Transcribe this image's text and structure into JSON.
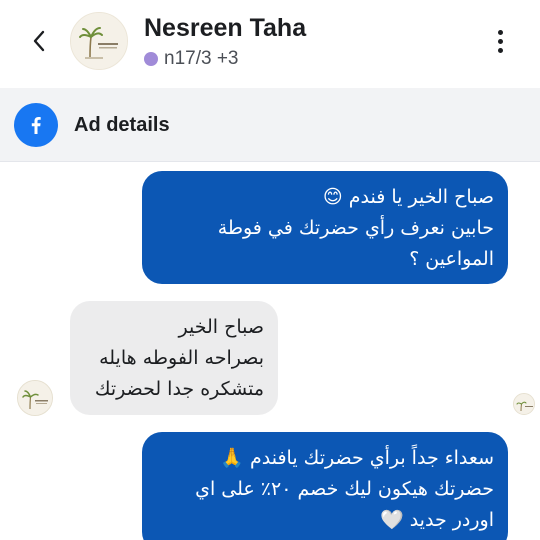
{
  "header": {
    "contact_name": "Nesreen Taha",
    "tag_text": "n17/3 +3",
    "tag_color": "#a08bd8",
    "back_icon": "chevron-left-icon",
    "more_icon": "more-vertical-icon"
  },
  "ad_bar": {
    "label": "Ad details",
    "icon": "facebook-icon",
    "icon_color": "#1877f2"
  },
  "messages": [
    {
      "direction": "outgoing",
      "lines": [
        "صباح الخير يا فندم 😊",
        "حابين نعرف رأي حضرتك في فوطة",
        "المواعين ؟"
      ]
    },
    {
      "direction": "incoming",
      "lines": [
        "صباح الخير",
        "بصراحه الفوطه هايله",
        "متشكره جدا لحضرتك"
      ]
    },
    {
      "direction": "outgoing",
      "lines": [
        "سعداء جداً برأي حضرتك يافندم 🙏",
        "حضرتك هيكون ليك خصم ٢٠٪ على اي",
        "اوردر جديد 🤍"
      ]
    }
  ],
  "colors": {
    "outgoing_bubble": "#0c57b4",
    "incoming_bubble": "#ececed"
  }
}
